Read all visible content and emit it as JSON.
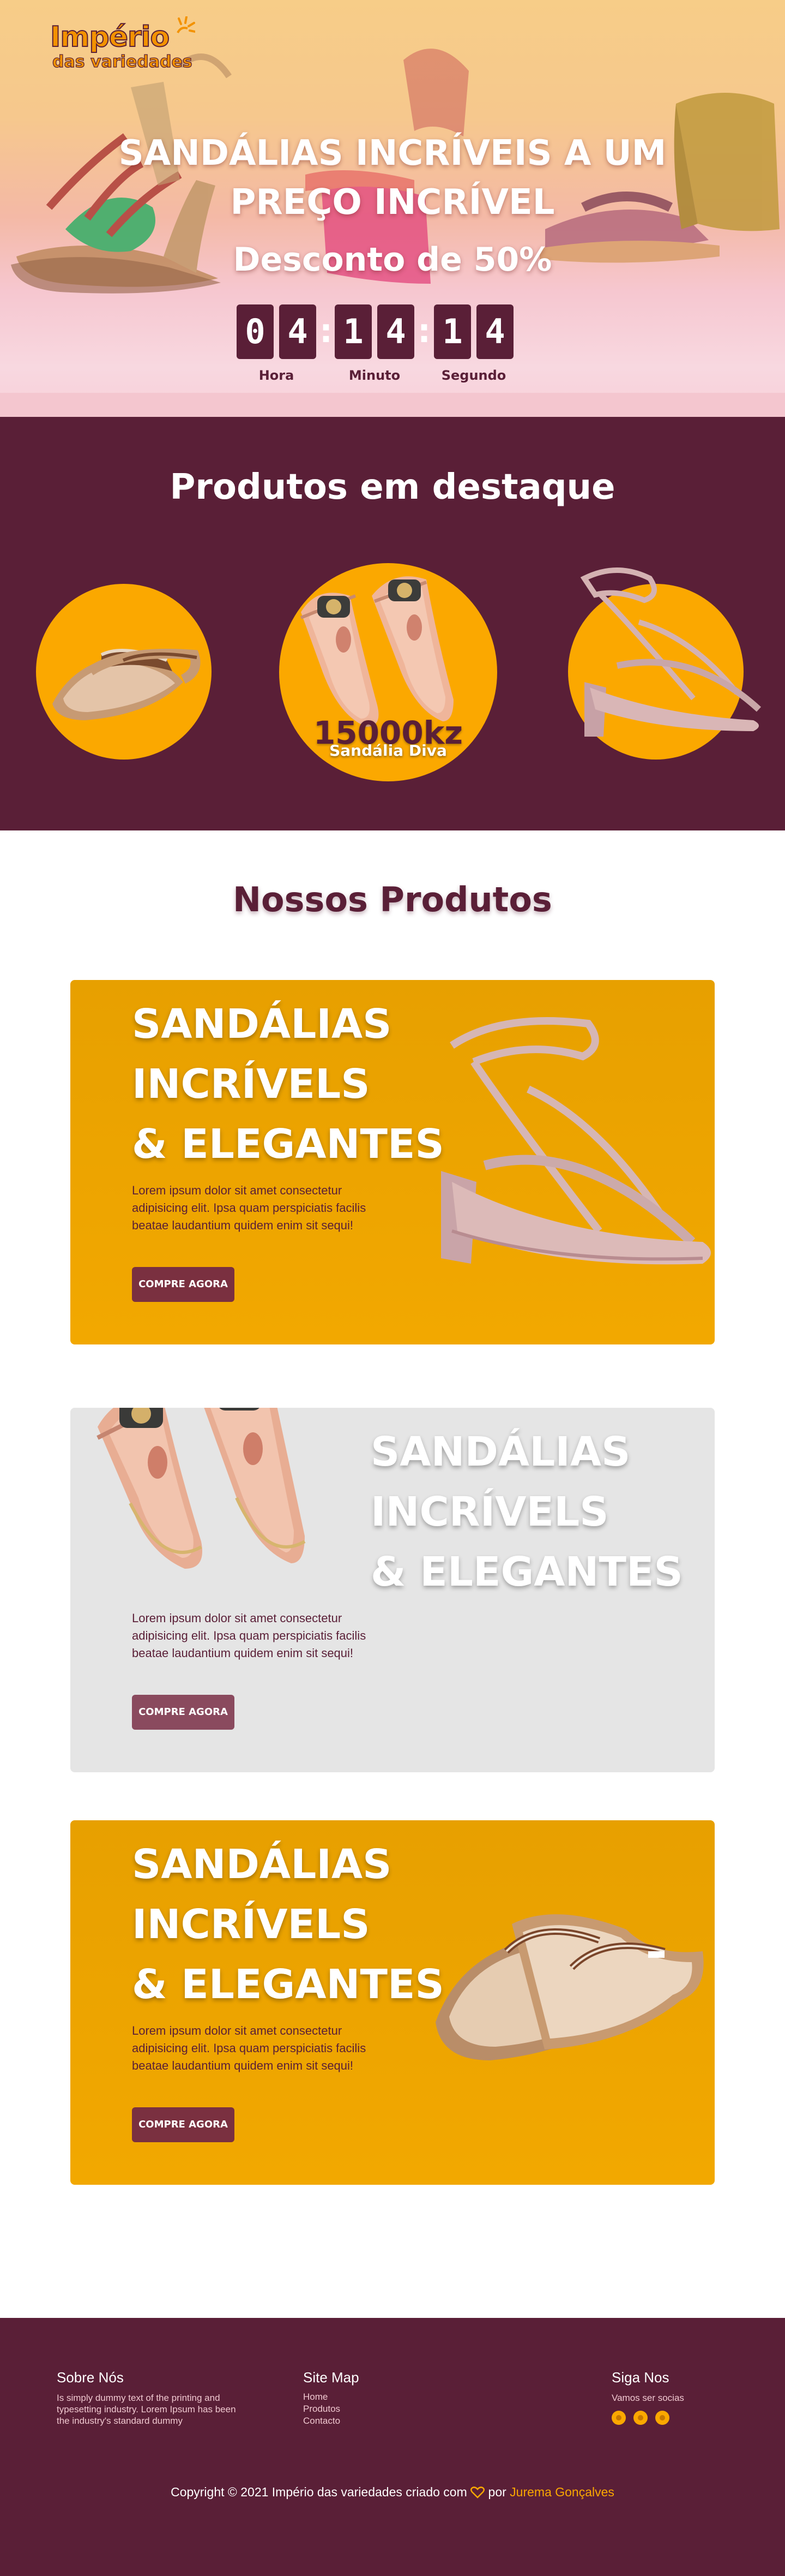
{
  "header": {
    "logo_main": "Império",
    "logo_sub": "das variedades"
  },
  "hero": {
    "title_line1": "SANDÁLIAS INCRÍVEIS A UM",
    "title_line2": "PREÇO INCRÍVEL",
    "subtitle": "Desconto de 50%",
    "countdown": {
      "hours": [
        "0",
        "4"
      ],
      "minutes": [
        "1",
        "4"
      ],
      "seconds": [
        "1",
        "4"
      ],
      "hours_label": "Hora",
      "minutes_label": "Minuto",
      "seconds_label": "Segundo"
    }
  },
  "featured": {
    "title": "Produtos em destaque",
    "center_price": "15000kz",
    "center_name": "Sandália Diva"
  },
  "products": {
    "title": "Nossos Produtos",
    "cards": [
      {
        "title_lines": [
          "SANDÁLIAS",
          "INCRÍVELS",
          "& ELEGANTES"
        ],
        "text": "Lorem ipsum dolor sit amet consectetur adipisicing elit. Ipsa quam perspiciatis facilis beatae laudantium quidem enim sit sequi!",
        "button": "COMPRE AGORA"
      },
      {
        "title_lines": [
          "SANDÁLIAS",
          "INCRÍVELS",
          "& ELEGANTES"
        ],
        "text": "Lorem ipsum dolor sit amet consectetur adipisicing elit. Ipsa quam perspiciatis facilis beatae laudantium quidem enim sit sequi!",
        "button": "COMPRE AGORA"
      },
      {
        "title_lines": [
          "SANDÁLIAS",
          "INCRÍVELS",
          "& ELEGANTES"
        ],
        "text": "Lorem ipsum dolor sit amet consectetur adipisicing elit. Ipsa quam perspiciatis facilis beatae laudantium quidem enim sit sequi!",
        "button": "COMPRE AGORA"
      }
    ]
  },
  "footer": {
    "about_title": "Sobre Nós",
    "about_text": "Is simply dummy text of the printing and typesetting industry. Lorem Ipsum has been the industry's standard dummy",
    "sitemap_title": "Site Map",
    "sitemap_links": [
      "Home",
      "Produtos",
      "Contacto"
    ],
    "follow_title": "Siga Nos",
    "follow_text": "Vamos ser socias",
    "copyright_before": "Copyright © 2021 Império das variedades criado com",
    "copyright_by": "por",
    "copyright_author": "Jurema Gonçalves"
  },
  "colors": {
    "brand_wine": "#5a1f37",
    "brand_orange": "#fba800",
    "card_orange": "#e7a000",
    "card_gray": "#e5e5e5"
  }
}
